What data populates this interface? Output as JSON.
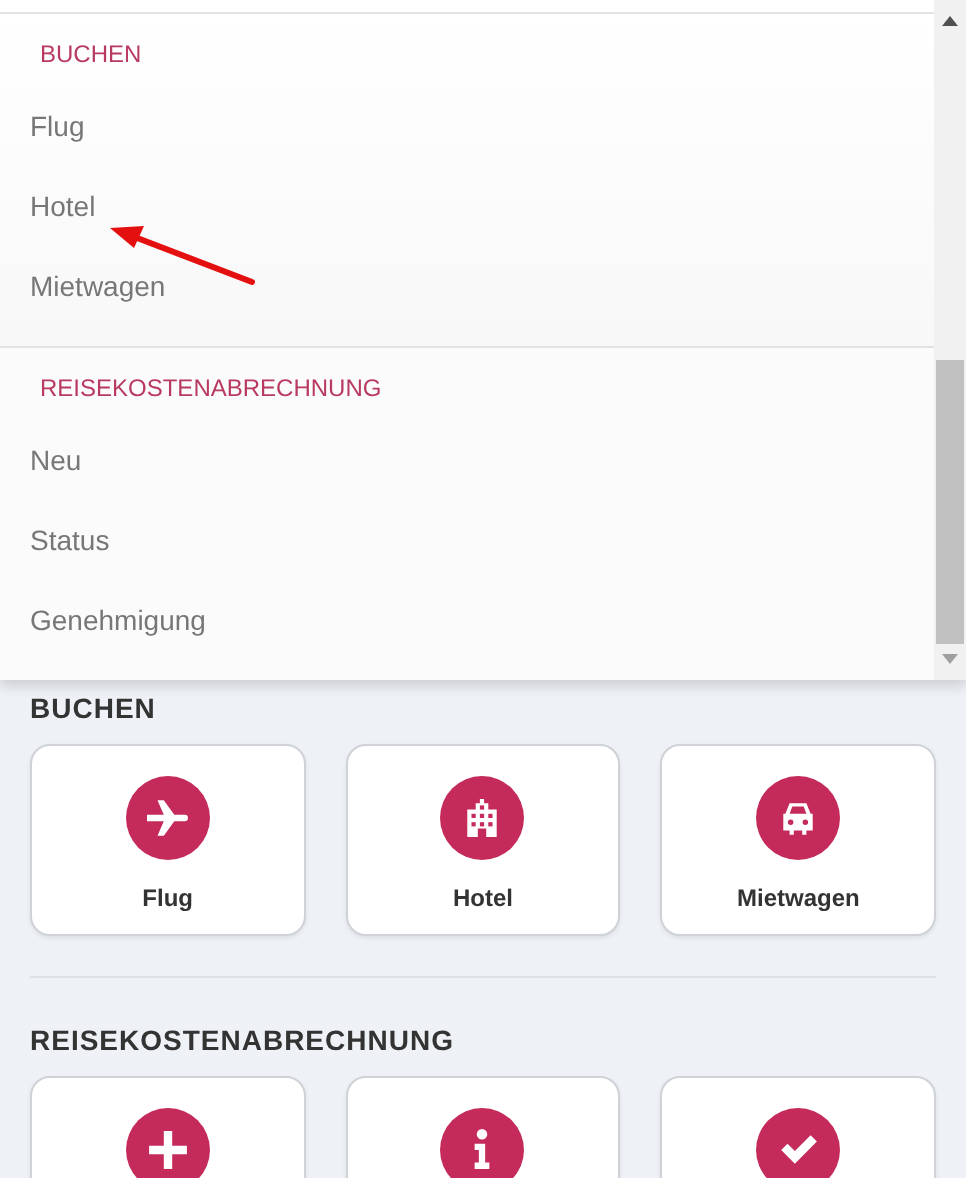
{
  "menu": {
    "sections": [
      {
        "heading": "BUCHEN",
        "items": [
          {
            "label": "Flug"
          },
          {
            "label": "Hotel"
          },
          {
            "label": "Mietwagen"
          }
        ]
      },
      {
        "heading": "REISEKOSTENABRECHNUNG",
        "items": [
          {
            "label": "Neu"
          },
          {
            "label": "Status"
          },
          {
            "label": "Genehmigung"
          }
        ]
      }
    ]
  },
  "sections": [
    {
      "heading": "BUCHEN",
      "tiles": [
        {
          "kind": "plane",
          "label": "Flug"
        },
        {
          "kind": "building",
          "label": "Hotel"
        },
        {
          "kind": "car",
          "label": "Mietwagen"
        }
      ]
    },
    {
      "heading": "REISEKOSTENABRECHNUNG",
      "tiles": [
        {
          "kind": "plus"
        },
        {
          "kind": "info"
        },
        {
          "kind": "check"
        }
      ]
    }
  ]
}
